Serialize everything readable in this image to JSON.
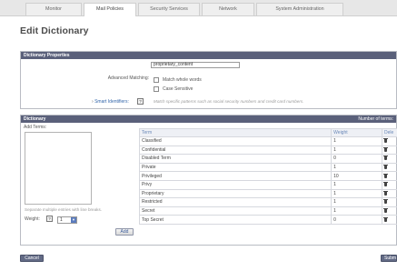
{
  "nav": {
    "tabs": [
      {
        "label": "Monitor",
        "active": false
      },
      {
        "label": "Mail Policies",
        "active": true
      },
      {
        "label": "Security Services",
        "active": false
      },
      {
        "label": "Network",
        "active": false
      },
      {
        "label": "System Administration",
        "active": false
      }
    ]
  },
  "page": {
    "title": "Edit Dictionary"
  },
  "properties": {
    "header": "Dictionary Properties",
    "name_label": "Name:",
    "name_value": "proprietary_content",
    "advanced_label": "Advanced Matching:",
    "match_whole_words": "Match whole words",
    "case_sensitive": "Case Sensitive",
    "smart_identifiers_label": "Smart Identifiers:",
    "smart_identifiers_hint": "Match specific patterns such as social security numbers and credit card numbers."
  },
  "dictionary": {
    "header": "Dictionary",
    "header_right": "Number of terms:",
    "add_terms_label": "Add Terms:",
    "separate_hint": "Separate multiple entries with line breaks.",
    "weight_label": "Weight:",
    "weight_value": "1",
    "add_button": "Add",
    "columns": {
      "term": "Term",
      "weight": "Weight",
      "delete": "Dele"
    },
    "rows": [
      {
        "term": "Classified",
        "weight": "1"
      },
      {
        "term": "Confidential",
        "weight": "1"
      },
      {
        "term": "Disabled Term",
        "weight": "0"
      },
      {
        "term": "Private",
        "weight": "1"
      },
      {
        "term": "Privileged",
        "weight": "10"
      },
      {
        "term": "Privy",
        "weight": "1"
      },
      {
        "term": "Proprietary",
        "weight": "1"
      },
      {
        "term": "Restricted",
        "weight": "1"
      },
      {
        "term": "Secret",
        "weight": "1"
      },
      {
        "term": "Top Secret",
        "weight": "0"
      }
    ]
  },
  "footer": {
    "cancel": "Cancel",
    "submit": "Subm"
  },
  "icons": {
    "help": "?",
    "trash": "trash-icon",
    "dropdown": "chevron-down-icon"
  }
}
